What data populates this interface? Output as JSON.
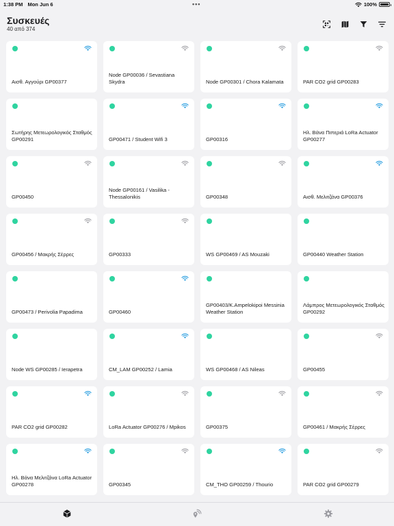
{
  "status_bar": {
    "time": "1:38 PM",
    "date": "Mon Jun 6",
    "battery": "100%"
  },
  "header": {
    "title": "Συσκευές",
    "subtitle": "40 από 374"
  },
  "toolbar": {
    "icons": [
      "qr-scan-icon",
      "map-icon",
      "filter-icon",
      "sort-icon"
    ]
  },
  "colors": {
    "online_dot": "#2fd4a0",
    "wifi_strong": "#2c9fe0",
    "wifi_weak": "#a3a3a8"
  },
  "devices": [
    {
      "label": "Αισθ. Αγγούρι GP00377",
      "wifi": "strong"
    },
    {
      "label": "Node GP00036 / Sevastiana Skydra",
      "wifi": "weak"
    },
    {
      "label": "Node GP00301 / Chora Kalamata",
      "wifi": "weak"
    },
    {
      "label": "PAR CO2 grid GP00283",
      "wifi": "weak"
    },
    {
      "label": "Σωτήρης Μετεωρολογικός Σταθμός GP00291",
      "wifi": ""
    },
    {
      "label": "GP00471 / Student Wifi 3",
      "wifi": "strong"
    },
    {
      "label": "GP00316",
      "wifi": "strong"
    },
    {
      "label": "Ηλ. Βάνα Πιπεριά LoRa Actuator GP00277",
      "wifi": "strong"
    },
    {
      "label": "GP00450",
      "wifi": "weak"
    },
    {
      "label": "Node GP00161 / Vasilika - Thessalonikis",
      "wifi": "weak"
    },
    {
      "label": "GP00348",
      "wifi": "weak"
    },
    {
      "label": "Αισθ. Μελιτζάνα GP00376",
      "wifi": "strong"
    },
    {
      "label": "GP00456 / Μακρής Σέρρες",
      "wifi": "weak"
    },
    {
      "label": "GP00333",
      "wifi": "weak"
    },
    {
      "label": "WS GP00469 / AS Mouzaki",
      "wifi": ""
    },
    {
      "label": "GP00440 Weather Station",
      "wifi": ""
    },
    {
      "label": "GP00473 / Perivolia Papadima",
      "wifi": ""
    },
    {
      "label": "GP00460",
      "wifi": "strong"
    },
    {
      "label": "GP00403/Κ.Ampelokipoi Messinia Weather Station",
      "wifi": ""
    },
    {
      "label": "Λάμπρος Μετεωρολογικός Σταθμός GP00292",
      "wifi": ""
    },
    {
      "label": "Node WS GP00285 / Ierapetra",
      "wifi": ""
    },
    {
      "label": "CM_LAM GP00252 / Lamia",
      "wifi": "strong"
    },
    {
      "label": "WS GP00468 / AS Nileas",
      "wifi": ""
    },
    {
      "label": "GP00455",
      "wifi": "weak"
    },
    {
      "label": "PAR CO2 grid GP00282",
      "wifi": "strong"
    },
    {
      "label": "LoRa Actuator GP00276 / Mpikos",
      "wifi": "weak"
    },
    {
      "label": "GP00375",
      "wifi": "weak"
    },
    {
      "label": "GP00461 / Μακρής Σέρρες",
      "wifi": "weak"
    },
    {
      "label": "Ηλ. Βάνα Μελιτζάνα LoRa Actuator GP00278",
      "wifi": "strong"
    },
    {
      "label": "GP00345",
      "wifi": "weak"
    },
    {
      "label": "CM_THO GP00259 / Thourio",
      "wifi": "strong"
    },
    {
      "label": "PAR CO2 grid GP00279",
      "wifi": "weak"
    }
  ],
  "tabbar": {
    "tabs": [
      "devices-cube-icon",
      "location-signal-icon",
      "settings-gear-icon"
    ],
    "active_index": 0
  }
}
